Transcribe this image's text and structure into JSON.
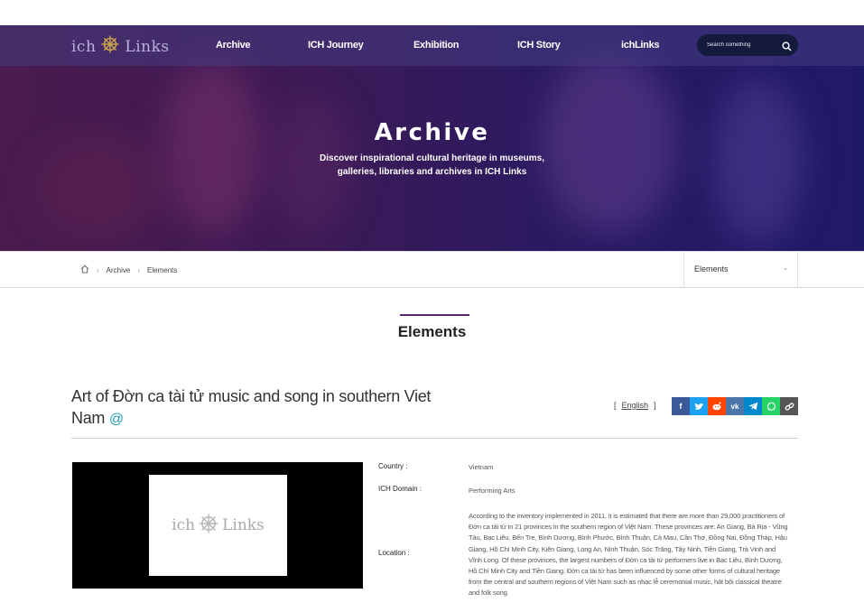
{
  "header": {
    "logo_left": "ich",
    "logo_right": "Links",
    "nav": [
      "Archive",
      "ICH Journey",
      "Exhibition",
      "ICH Story",
      "ichLinks"
    ],
    "search_placeholder": "Search something"
  },
  "hero": {
    "title": "Archive",
    "subtitle_line1": "Discover inspirational cultural heritage in museums,",
    "subtitle_line2": "galleries, libraries and archives in ICH Links"
  },
  "breadcrumb": {
    "items": [
      "Archive",
      "Elements"
    ],
    "select_value": "Elements"
  },
  "section": {
    "title": "Elements"
  },
  "element": {
    "title_line1": "Art of Đờn ca tài tử music and song in southern Viet",
    "title_line2": "Nam",
    "at_symbol": "@",
    "language_link": "English",
    "lang_open": "[",
    "lang_close": "]",
    "share_icons": [
      "facebook-icon",
      "twitter-icon",
      "reddit-icon",
      "vk-icon",
      "telegram-icon",
      "whatsapp-icon",
      "link-icon"
    ],
    "share_colors": [
      "#3b5998",
      "#1da1f2",
      "#ff4500",
      "#4a76a8",
      "#0088cc",
      "#25d366",
      "#555555"
    ]
  },
  "media": {
    "logo_left": "ich",
    "logo_right": "Links"
  },
  "details": {
    "country_label": "Country :",
    "country_value": "Vietnam",
    "domain_label": "ICH Domain :",
    "domain_value": "Performing Arts",
    "location_label": "Location :",
    "location_value": "According to the inventory implemented in 2011, it is estimated that there are more than 29,000 practitioners of Đờn ca tài tử in 21 provinces in the southern region of Việt Nam. These provinces are: An Giang, Bà Rịa - Vũng Tàu, Bạc Liêu, Bến Tre, Bình Dương, Bình Phước, Bình Thuận, Cà Mau, Cần Thơ, Đồng Nai, Đồng Tháp, Hậu Giang, Hồ Chí Minh City, Kiên Giang, Long An, Ninh Thuận, Sóc Trăng, Tây Ninh, Tiền Giang, Trà Vinh and Vĩnh Long. Of these provinces, the largest numbers of Đờn ca tài tử performers live in Bạc Liêu, Bình Dương, Hồ Chí Minh City and Tiền Giang. Đờn ca tài tử has been influenced by some other forms of cultural heritage from the central and southern regions of Việt Nam such as nhạc lễ ceremonial music, hát bội classical theatre and folk song."
  }
}
